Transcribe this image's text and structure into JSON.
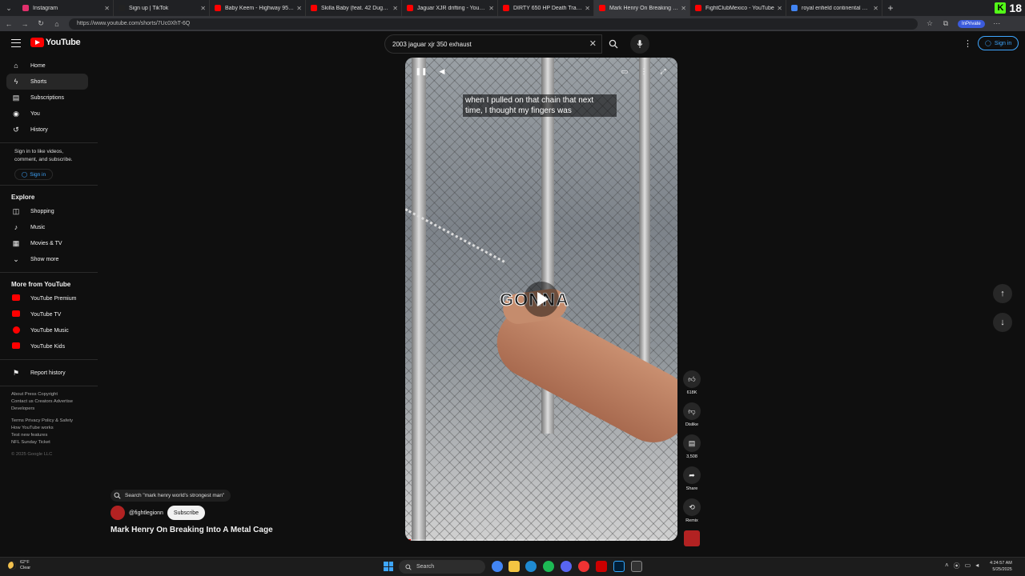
{
  "browser": {
    "tabs": [
      {
        "title": "Instagram",
        "color": "#e1306c"
      },
      {
        "title": "Sign up | TikTok",
        "color": "#222222"
      },
      {
        "title": "Baby Keem - Highway 95 pt. 2 (Of...",
        "color": "#ff0000"
      },
      {
        "title": "Skilla Baby (feat. 42 Dugg) - Wer...",
        "color": "#ff0000"
      },
      {
        "title": "Jaguar XJR drifting - YouTube",
        "color": "#ff0000"
      },
      {
        "title": "DIRTY 650 HP Death Trap | Big Tur...",
        "color": "#ff0000"
      },
      {
        "title": "Mark Henry On Breaking Into...",
        "color": "#ff0000"
      },
      {
        "title": "FightClubMexico - YouTube",
        "color": "#ff0000"
      },
      {
        "title": "royal enfield continental gt 650 b...",
        "color": "#4285f4"
      }
    ],
    "url": "https://www.youtube.com/shorts/7Uc0XhT-6Q",
    "inprivate_label": "InPrivate",
    "kick_badge": "18"
  },
  "header": {
    "logo_text": "YouTube",
    "search_value": "2003 jaguar xjr 350 exhaust",
    "sign_in": "Sign in"
  },
  "sidebar": {
    "main": [
      {
        "label": "Home",
        "icon": "home-icon"
      },
      {
        "label": "Shorts",
        "icon": "shorts-icon"
      },
      {
        "label": "Subscriptions",
        "icon": "subscriptions-icon"
      },
      {
        "label": "You",
        "icon": "user-icon"
      },
      {
        "label": "History",
        "icon": "history-icon"
      }
    ],
    "signin_text": "Sign in to like videos, comment, and subscribe.",
    "signin_button": "Sign in",
    "explore_title": "Explore",
    "explore": [
      {
        "label": "Shopping",
        "icon": "shopping-bag-icon"
      },
      {
        "label": "Music",
        "icon": "music-note-icon"
      },
      {
        "label": "Movies & TV",
        "icon": "film-icon"
      },
      {
        "label": "Show more",
        "icon": "chevron-down-icon"
      }
    ],
    "more_title": "More from YouTube",
    "more": [
      {
        "label": "YouTube Premium"
      },
      {
        "label": "YouTube TV"
      },
      {
        "label": "YouTube Music"
      },
      {
        "label": "YouTube Kids"
      }
    ],
    "report_history": "Report history",
    "footer_lines": [
      "About  Press  Copyright",
      "Contact us  Creators  Advertise",
      "Developers",
      "Terms  Privacy  Policy & Safety",
      "How YouTube works",
      "Test new features",
      "NFL Sunday Ticket"
    ],
    "copyright": "© 2025 Google LLC"
  },
  "video": {
    "caption_line1": "when I pulled on that chain that next",
    "caption_line2": "time, I thought my fingers was",
    "overlay_word": "GONNA",
    "progress": 0.02
  },
  "actions": {
    "likes": "618K",
    "dislike": "Dislike",
    "comments": "3,508",
    "share": "Share",
    "remix": "Remix"
  },
  "info": {
    "related_search": "Search \"mark henry world's strongest man\"",
    "channel": "@fightlegionn",
    "subscribe": "Subscribe",
    "title": "Mark Henry On Breaking Into A Metal Cage"
  },
  "taskbar": {
    "temp": "62°F",
    "condition": "Clear",
    "search": "Search",
    "time": "4:24:57 AM",
    "date": "5/25/2025"
  }
}
